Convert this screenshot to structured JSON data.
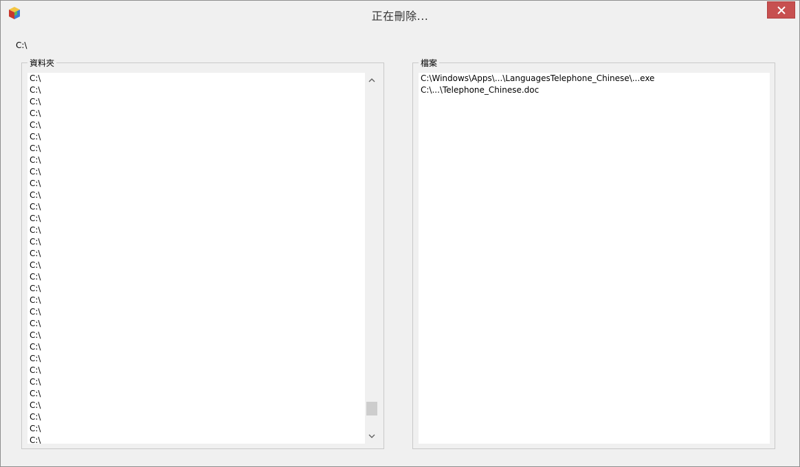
{
  "window": {
    "title": "正在刪除..."
  },
  "current_path": "C:\\",
  "folders": {
    "title": "資料夾",
    "items": [
      "C:\\",
      "C:\\",
      "C:\\",
      "C:\\",
      "C:\\",
      "C:\\",
      "C:\\",
      "C:\\",
      "C:\\",
      "C:\\",
      "C:\\",
      "C:\\",
      "C:\\",
      "C:\\",
      "C:\\",
      "C:\\",
      "C:\\",
      "C:\\",
      "C:\\",
      "C:\\",
      "C:\\",
      "C:\\",
      "C:\\",
      "C:\\",
      "C:\\",
      "C:\\",
      "C:\\",
      "C:\\",
      "C:\\",
      "C:\\",
      "C:\\",
      "C:\\"
    ],
    "scroll_position": 0.96
  },
  "files": {
    "title": "檔案",
    "items": [
      "C:\\Windows\\Apps\\...\\LanguagesTelephone_Chinese\\...exe",
      "C:\\...\\Telephone_Chinese.doc"
    ]
  },
  "icons": {
    "app": "app-cube-icon",
    "close": "close-icon",
    "scroll_up": "chevron-up-icon",
    "scroll_down": "chevron-down-icon"
  },
  "colors": {
    "close_button": "#c75050",
    "window_bg": "#f0f0f0",
    "list_bg": "#ffffff"
  }
}
